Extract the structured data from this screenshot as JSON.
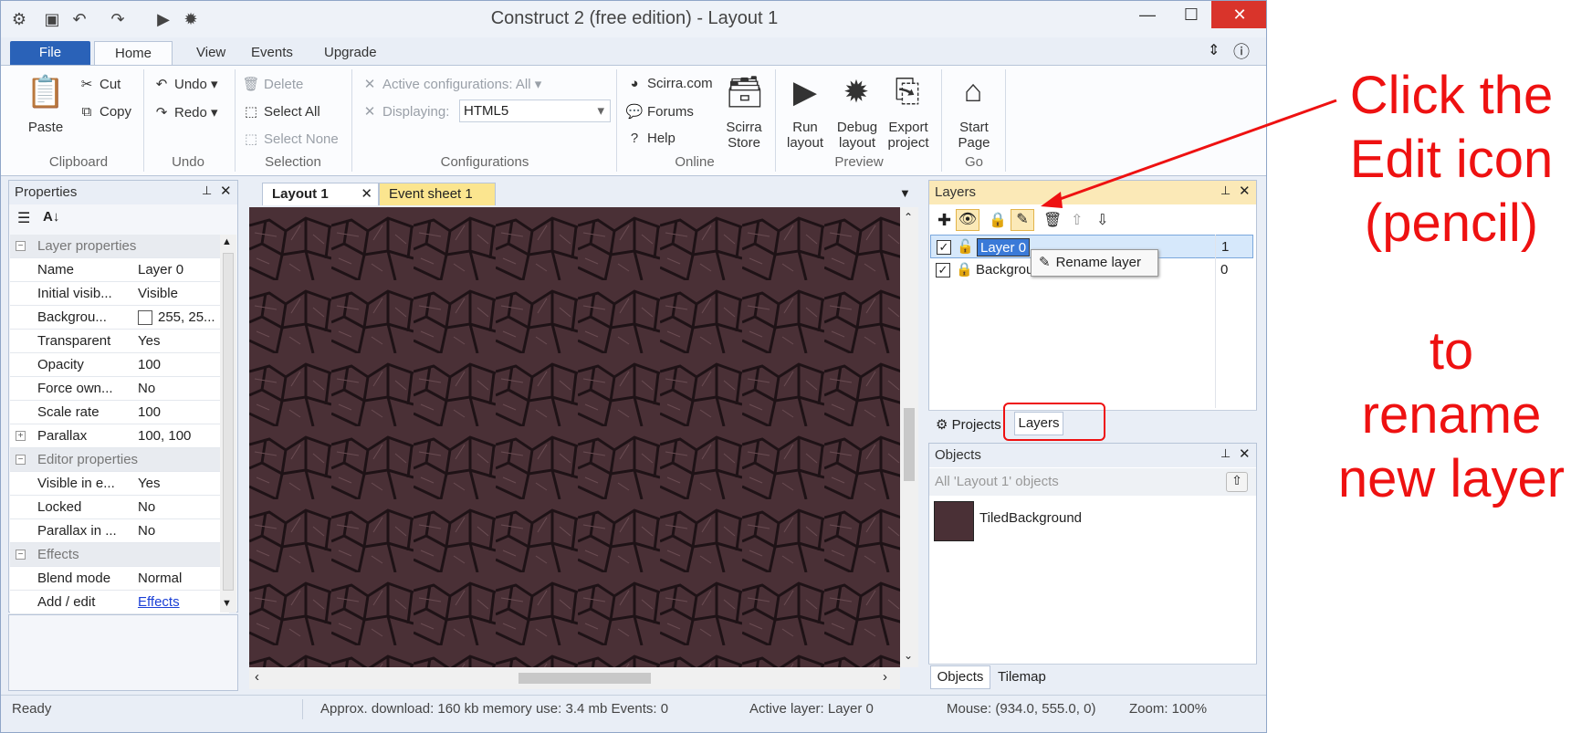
{
  "window": {
    "title": "Construct 2  (free edition) - Layout 1"
  },
  "ribbon_tabs": [
    "File",
    "Home",
    "View",
    "Events",
    "Upgrade"
  ],
  "clipboard": {
    "paste": "Paste",
    "cut": "Cut",
    "copy": "Copy",
    "label": "Clipboard"
  },
  "undo": {
    "undo": "Undo",
    "redo": "Redo",
    "label": "Undo"
  },
  "selection": {
    "delete": "Delete",
    "select_all": "Select All",
    "select_none": "Select None",
    "label": "Selection"
  },
  "configurations": {
    "active": "Active configurations: All",
    "displaying": "Displaying:",
    "display_value": "HTML5",
    "label": "Configurations"
  },
  "online": {
    "scirra": "Scirra.com",
    "forums": "Forums",
    "help": "Help",
    "store": "Scirra Store",
    "label": "Online"
  },
  "preview": {
    "run": "Run layout",
    "debug": "Debug layout",
    "export": "Export project",
    "label": "Preview"
  },
  "go": {
    "start": "Start Page",
    "label": "Go"
  },
  "properties": {
    "title": "Properties",
    "rows": [
      {
        "cat": true,
        "key": "Layer properties",
        "exp": "⊟"
      },
      {
        "key": "Name",
        "value": "Layer 0"
      },
      {
        "key": "Initial visib...",
        "value": "Visible"
      },
      {
        "key": "Backgrou...",
        "value": "255, 25...",
        "swatch": true
      },
      {
        "key": "Transparent",
        "value": "Yes"
      },
      {
        "key": "Opacity",
        "value": "100"
      },
      {
        "key": "Force own...",
        "value": "No"
      },
      {
        "key": "Scale rate",
        "value": "100"
      },
      {
        "key": "Parallax",
        "value": "100, 100",
        "exp": "⊞"
      },
      {
        "cat": true,
        "key": "Editor properties",
        "exp": "⊟"
      },
      {
        "key": "Visible in e...",
        "value": "Yes"
      },
      {
        "key": "Locked",
        "value": "No"
      },
      {
        "key": "Parallax in ...",
        "value": "No"
      },
      {
        "cat": true,
        "key": "Effects",
        "exp": "⊟"
      },
      {
        "key": "Blend mode",
        "value": "Normal"
      },
      {
        "key": "Add / edit",
        "value": "Effects",
        "link": true
      }
    ]
  },
  "doc_tabs": {
    "layout": "Layout 1",
    "events": "Event sheet 1"
  },
  "layers": {
    "title": "Layers",
    "items": [
      {
        "name": "Layer 0",
        "index": "1",
        "selected": true
      },
      {
        "name": "Background",
        "index": "0",
        "selected": false
      }
    ],
    "tooltip": "Rename layer",
    "bottom_tabs": [
      "Projects",
      "Layers"
    ]
  },
  "objects": {
    "title": "Objects",
    "filter": "All 'Layout 1' objects",
    "items": [
      "TiledBackground"
    ],
    "bottom_tabs": [
      "Objects",
      "Tilemap"
    ]
  },
  "status": {
    "ready": "Ready",
    "download": "Approx. download: 160 kb  memory use: 3.4 mb  Events: 0",
    "active_layer": "Active layer: Layer 0",
    "mouse": "Mouse: (934.0, 555.0, 0)",
    "zoom": "Zoom: 100%"
  },
  "annotation": {
    "line1": "Click the",
    "line2": "Edit icon",
    "line3": "(pencil)",
    "line4": "to",
    "line5": "rename",
    "line6": "new layer"
  },
  "colors": {
    "annotation": "#ee1111",
    "file_tab": "#2a62b8",
    "close_button": "#d9342b",
    "active_panel": "#fbe9b7"
  }
}
